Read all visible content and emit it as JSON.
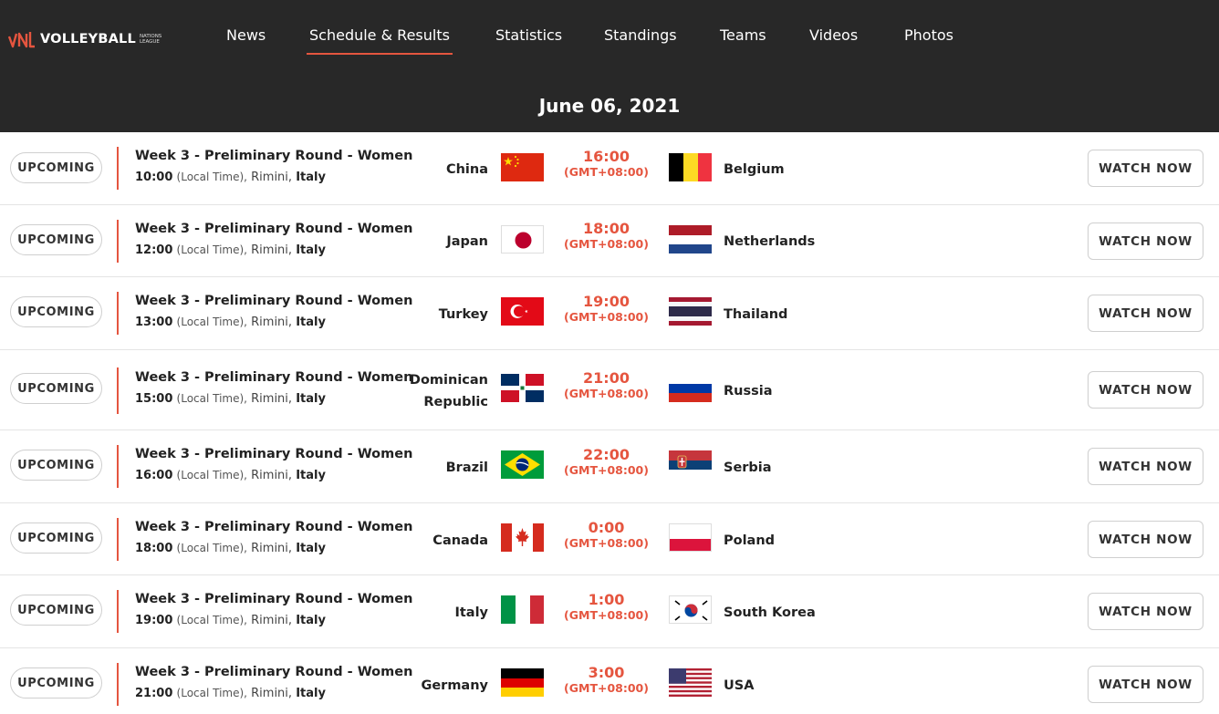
{
  "brand": {
    "name": "VOLLEYBALL",
    "sub": "NATIONS LEAGUE",
    "colors": {
      "accent": "#e5553f",
      "header_bg": "#282828"
    }
  },
  "nav": [
    {
      "label": "News"
    },
    {
      "label": "Schedule & Results",
      "active": true
    },
    {
      "label": "Statistics"
    },
    {
      "label": "Standings"
    },
    {
      "label": "Teams"
    },
    {
      "label": "Videos"
    },
    {
      "label": "Photos"
    }
  ],
  "date": "June 06, 2021",
  "matches": [
    {
      "status": "UPCOMING",
      "round": "Week 3 - Preliminary Round - Women",
      "local_time": "10:00",
      "local_label": "(Local Time),",
      "city": "Rimini,",
      "country": "Italy",
      "home": "China",
      "home_flag": "china-flag",
      "time": "16:00",
      "tz": "(GMT+08:00)",
      "away": "Belgium",
      "away_flag": "belgium-flag",
      "watch": "WATCH NOW"
    },
    {
      "status": "UPCOMING",
      "round": "Week 3 - Preliminary Round - Women",
      "local_time": "12:00",
      "local_label": "(Local Time),",
      "city": "Rimini,",
      "country": "Italy",
      "home": "Japan",
      "home_flag": "japan-flag",
      "time": "18:00",
      "tz": "(GMT+08:00)",
      "away": "Netherlands",
      "away_flag": "netherlands-flag",
      "watch": "WATCH NOW"
    },
    {
      "status": "UPCOMING",
      "round": "Week 3 - Preliminary Round - Women",
      "local_time": "13:00",
      "local_label": "(Local Time),",
      "city": "Rimini,",
      "country": "Italy",
      "home": "Turkey",
      "home_flag": "turkey-flag",
      "time": "19:00",
      "tz": "(GMT+08:00)",
      "away": "Thailand",
      "away_flag": "thailand-flag",
      "watch": "WATCH NOW"
    },
    {
      "status": "UPCOMING",
      "round": "Week 3 - Preliminary Round - Women",
      "local_time": "15:00",
      "local_label": "(Local Time),",
      "city": "Rimini,",
      "country": "Italy",
      "home": "Dominican Republic",
      "home_line1": "Dominican",
      "home_line2": "Republic",
      "home_flag": "dominican-republic-flag",
      "time": "21:00",
      "tz": "(GMT+08:00)",
      "away": "Russia",
      "away_flag": "russia-flag",
      "watch": "WATCH NOW"
    },
    {
      "status": "UPCOMING",
      "round": "Week 3 - Preliminary Round - Women",
      "local_time": "16:00",
      "local_label": "(Local Time),",
      "city": "Rimini,",
      "country": "Italy",
      "home": "Brazil",
      "home_flag": "brazil-flag",
      "time": "22:00",
      "tz": "(GMT+08:00)",
      "away": "Serbia",
      "away_flag": "serbia-flag",
      "watch": "WATCH NOW"
    },
    {
      "status": "UPCOMING",
      "round": "Week 3 - Preliminary Round - Women",
      "local_time": "18:00",
      "local_label": "(Local Time),",
      "city": "Rimini,",
      "country": "Italy",
      "home": "Canada",
      "home_flag": "canada-flag",
      "time": "0:00",
      "tz": "(GMT+08:00)",
      "away": "Poland",
      "away_flag": "poland-flag",
      "watch": "WATCH NOW"
    },
    {
      "status": "UPCOMING",
      "round": "Week 3 - Preliminary Round - Women",
      "local_time": "19:00",
      "local_label": "(Local Time),",
      "city": "Rimini,",
      "country": "Italy",
      "home": "Italy",
      "home_flag": "italy-flag",
      "time": "1:00",
      "tz": "(GMT+08:00)",
      "away": "South Korea",
      "away_flag": "south-korea-flag",
      "watch": "WATCH NOW"
    },
    {
      "status": "UPCOMING",
      "round": "Week 3 - Preliminary Round - Women",
      "local_time": "21:00",
      "local_label": "(Local Time),",
      "city": "Rimini,",
      "country": "Italy",
      "home": "Germany",
      "home_flag": "germany-flag",
      "time": "3:00",
      "tz": "(GMT+08:00)",
      "away": "USA",
      "away_flag": "usa-flag",
      "watch": "WATCH NOW"
    }
  ]
}
